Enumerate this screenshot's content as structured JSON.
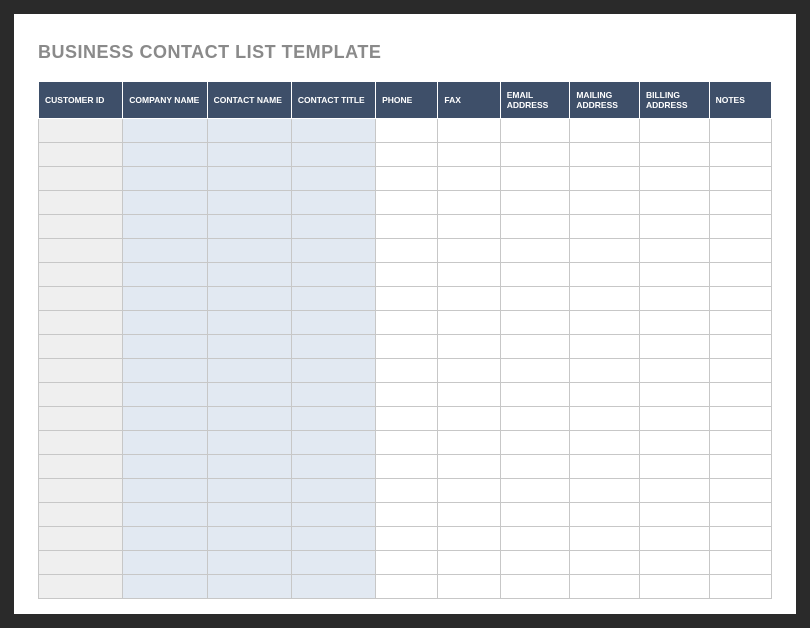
{
  "title": "BUSINESS CONTACT LIST TEMPLATE",
  "columns": [
    "CUSTOMER ID",
    "COMPANY NAME",
    "CONTACT NAME",
    "CONTACT TITLE",
    "PHONE",
    "FAX",
    "EMAIL ADDRESS",
    "MAILING ADDRESS",
    "BILLING ADDRESS",
    "NOTES"
  ],
  "rows": [
    [
      "",
      "",
      "",
      "",
      "",
      "",
      "",
      "",
      "",
      ""
    ],
    [
      "",
      "",
      "",
      "",
      "",
      "",
      "",
      "",
      "",
      ""
    ],
    [
      "",
      "",
      "",
      "",
      "",
      "",
      "",
      "",
      "",
      ""
    ],
    [
      "",
      "",
      "",
      "",
      "",
      "",
      "",
      "",
      "",
      ""
    ],
    [
      "",
      "",
      "",
      "",
      "",
      "",
      "",
      "",
      "",
      ""
    ],
    [
      "",
      "",
      "",
      "",
      "",
      "",
      "",
      "",
      "",
      ""
    ],
    [
      "",
      "",
      "",
      "",
      "",
      "",
      "",
      "",
      "",
      ""
    ],
    [
      "",
      "",
      "",
      "",
      "",
      "",
      "",
      "",
      "",
      ""
    ],
    [
      "",
      "",
      "",
      "",
      "",
      "",
      "",
      "",
      "",
      ""
    ],
    [
      "",
      "",
      "",
      "",
      "",
      "",
      "",
      "",
      "",
      ""
    ],
    [
      "",
      "",
      "",
      "",
      "",
      "",
      "",
      "",
      "",
      ""
    ],
    [
      "",
      "",
      "",
      "",
      "",
      "",
      "",
      "",
      "",
      ""
    ],
    [
      "",
      "",
      "",
      "",
      "",
      "",
      "",
      "",
      "",
      ""
    ],
    [
      "",
      "",
      "",
      "",
      "",
      "",
      "",
      "",
      "",
      ""
    ],
    [
      "",
      "",
      "",
      "",
      "",
      "",
      "",
      "",
      "",
      ""
    ],
    [
      "",
      "",
      "",
      "",
      "",
      "",
      "",
      "",
      "",
      ""
    ],
    [
      "",
      "",
      "",
      "",
      "",
      "",
      "",
      "",
      "",
      ""
    ],
    [
      "",
      "",
      "",
      "",
      "",
      "",
      "",
      "",
      "",
      ""
    ],
    [
      "",
      "",
      "",
      "",
      "",
      "",
      "",
      "",
      "",
      ""
    ],
    [
      "",
      "",
      "",
      "",
      "",
      "",
      "",
      "",
      "",
      ""
    ]
  ],
  "colors": {
    "header_bg": "#3e4f69",
    "id_col_bg": "#efefef",
    "blue_col_bg": "#e2e9f2"
  }
}
